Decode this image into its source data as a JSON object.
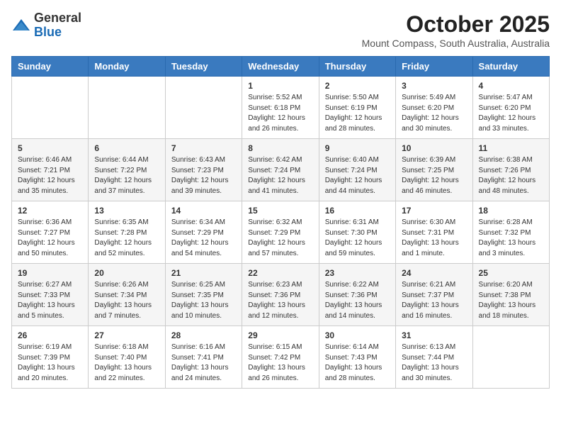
{
  "header": {
    "logo_general": "General",
    "logo_blue": "Blue",
    "month": "October 2025",
    "location": "Mount Compass, South Australia, Australia"
  },
  "days_of_week": [
    "Sunday",
    "Monday",
    "Tuesday",
    "Wednesday",
    "Thursday",
    "Friday",
    "Saturday"
  ],
  "weeks": [
    [
      {
        "day": "",
        "info": ""
      },
      {
        "day": "",
        "info": ""
      },
      {
        "day": "",
        "info": ""
      },
      {
        "day": "1",
        "info": "Sunrise: 5:52 AM\nSunset: 6:18 PM\nDaylight: 12 hours\nand 26 minutes."
      },
      {
        "day": "2",
        "info": "Sunrise: 5:50 AM\nSunset: 6:19 PM\nDaylight: 12 hours\nand 28 minutes."
      },
      {
        "day": "3",
        "info": "Sunrise: 5:49 AM\nSunset: 6:20 PM\nDaylight: 12 hours\nand 30 minutes."
      },
      {
        "day": "4",
        "info": "Sunrise: 5:47 AM\nSunset: 6:20 PM\nDaylight: 12 hours\nand 33 minutes."
      }
    ],
    [
      {
        "day": "5",
        "info": "Sunrise: 6:46 AM\nSunset: 7:21 PM\nDaylight: 12 hours\nand 35 minutes."
      },
      {
        "day": "6",
        "info": "Sunrise: 6:44 AM\nSunset: 7:22 PM\nDaylight: 12 hours\nand 37 minutes."
      },
      {
        "day": "7",
        "info": "Sunrise: 6:43 AM\nSunset: 7:23 PM\nDaylight: 12 hours\nand 39 minutes."
      },
      {
        "day": "8",
        "info": "Sunrise: 6:42 AM\nSunset: 7:24 PM\nDaylight: 12 hours\nand 41 minutes."
      },
      {
        "day": "9",
        "info": "Sunrise: 6:40 AM\nSunset: 7:24 PM\nDaylight: 12 hours\nand 44 minutes."
      },
      {
        "day": "10",
        "info": "Sunrise: 6:39 AM\nSunset: 7:25 PM\nDaylight: 12 hours\nand 46 minutes."
      },
      {
        "day": "11",
        "info": "Sunrise: 6:38 AM\nSunset: 7:26 PM\nDaylight: 12 hours\nand 48 minutes."
      }
    ],
    [
      {
        "day": "12",
        "info": "Sunrise: 6:36 AM\nSunset: 7:27 PM\nDaylight: 12 hours\nand 50 minutes."
      },
      {
        "day": "13",
        "info": "Sunrise: 6:35 AM\nSunset: 7:28 PM\nDaylight: 12 hours\nand 52 minutes."
      },
      {
        "day": "14",
        "info": "Sunrise: 6:34 AM\nSunset: 7:29 PM\nDaylight: 12 hours\nand 54 minutes."
      },
      {
        "day": "15",
        "info": "Sunrise: 6:32 AM\nSunset: 7:29 PM\nDaylight: 12 hours\nand 57 minutes."
      },
      {
        "day": "16",
        "info": "Sunrise: 6:31 AM\nSunset: 7:30 PM\nDaylight: 12 hours\nand 59 minutes."
      },
      {
        "day": "17",
        "info": "Sunrise: 6:30 AM\nSunset: 7:31 PM\nDaylight: 13 hours\nand 1 minute."
      },
      {
        "day": "18",
        "info": "Sunrise: 6:28 AM\nSunset: 7:32 PM\nDaylight: 13 hours\nand 3 minutes."
      }
    ],
    [
      {
        "day": "19",
        "info": "Sunrise: 6:27 AM\nSunset: 7:33 PM\nDaylight: 13 hours\nand 5 minutes."
      },
      {
        "day": "20",
        "info": "Sunrise: 6:26 AM\nSunset: 7:34 PM\nDaylight: 13 hours\nand 7 minutes."
      },
      {
        "day": "21",
        "info": "Sunrise: 6:25 AM\nSunset: 7:35 PM\nDaylight: 13 hours\nand 10 minutes."
      },
      {
        "day": "22",
        "info": "Sunrise: 6:23 AM\nSunset: 7:36 PM\nDaylight: 13 hours\nand 12 minutes."
      },
      {
        "day": "23",
        "info": "Sunrise: 6:22 AM\nSunset: 7:36 PM\nDaylight: 13 hours\nand 14 minutes."
      },
      {
        "day": "24",
        "info": "Sunrise: 6:21 AM\nSunset: 7:37 PM\nDaylight: 13 hours\nand 16 minutes."
      },
      {
        "day": "25",
        "info": "Sunrise: 6:20 AM\nSunset: 7:38 PM\nDaylight: 13 hours\nand 18 minutes."
      }
    ],
    [
      {
        "day": "26",
        "info": "Sunrise: 6:19 AM\nSunset: 7:39 PM\nDaylight: 13 hours\nand 20 minutes."
      },
      {
        "day": "27",
        "info": "Sunrise: 6:18 AM\nSunset: 7:40 PM\nDaylight: 13 hours\nand 22 minutes."
      },
      {
        "day": "28",
        "info": "Sunrise: 6:16 AM\nSunset: 7:41 PM\nDaylight: 13 hours\nand 24 minutes."
      },
      {
        "day": "29",
        "info": "Sunrise: 6:15 AM\nSunset: 7:42 PM\nDaylight: 13 hours\nand 26 minutes."
      },
      {
        "day": "30",
        "info": "Sunrise: 6:14 AM\nSunset: 7:43 PM\nDaylight: 13 hours\nand 28 minutes."
      },
      {
        "day": "31",
        "info": "Sunrise: 6:13 AM\nSunset: 7:44 PM\nDaylight: 13 hours\nand 30 minutes."
      },
      {
        "day": "",
        "info": ""
      }
    ]
  ]
}
